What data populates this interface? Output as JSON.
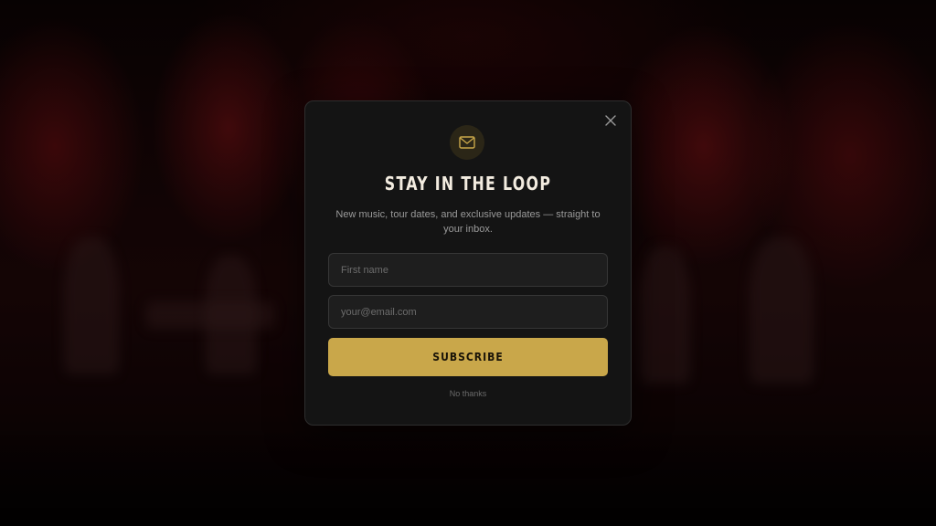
{
  "modal": {
    "title": "STAY IN THE LOOP",
    "subtitle": "New music, tour dates, and exclusive updates — straight to your inbox.",
    "first_name_placeholder": "First name",
    "email_placeholder": "your@email.com",
    "subscribe_label": "SUBSCRIBE",
    "dismiss_label": "No thanks",
    "accent_color": "#c9a74a",
    "icons": {
      "header": "envelope-icon",
      "close": "close-icon"
    }
  }
}
